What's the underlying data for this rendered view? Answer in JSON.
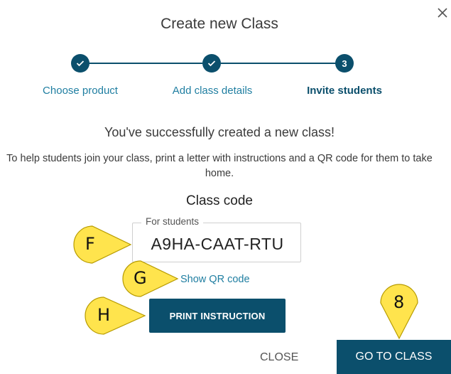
{
  "dialog": {
    "title": "Create new Class",
    "close_icon": "close-icon"
  },
  "stepper": {
    "steps": [
      {
        "label": "Choose product",
        "state": "done",
        "icon": "check-icon"
      },
      {
        "label": "Add class details",
        "state": "done",
        "icon": "check-icon"
      },
      {
        "label": "Invite students",
        "state": "active",
        "number": "3"
      }
    ]
  },
  "content": {
    "success_message": "You've successfully created a new class!",
    "help_text": "To help students join your class, print a letter with instructions and a QR code for them to take home.",
    "class_code_heading": "Class code",
    "code_field_label": "For students",
    "code_value": "A9HA-CAAT-RTU",
    "qr_link": "Show QR code",
    "print_button": "PRINT INSTRUCTION"
  },
  "footer": {
    "close_button": "CLOSE",
    "go_to_class_button": "GO TO CLASS"
  },
  "callouts": {
    "f": "F",
    "g": "G",
    "h": "H",
    "eight": "8"
  },
  "colors": {
    "primary": "#0b4f6c",
    "link": "#1f7ea1",
    "callout": "#ffe44d"
  }
}
